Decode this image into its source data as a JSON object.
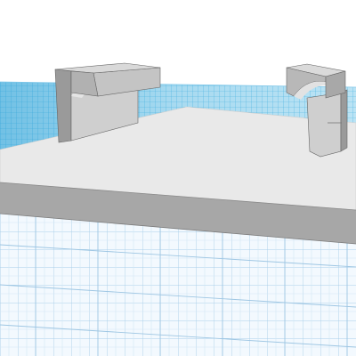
{
  "app": {
    "view": "3d-viewport",
    "theme_colors": {
      "sky": "#ffffff",
      "grid_back_light": "#bfe6f4",
      "grid_back_dark": "#2aa3d6",
      "grid_front": "#b9d8ef",
      "grid_front_bg": "#f6fbff",
      "plate_top": "#e8e8e8",
      "plate_side": "#a8a8a8",
      "part_light": "#d0d0d0",
      "part_mid": "#b5b5b5",
      "part_dark": "#8e8e8e",
      "edge": "#555555"
    }
  },
  "scene": {
    "objects": [
      {
        "name": "base-plate",
        "shape": "box"
      },
      {
        "name": "left-clip-bracket",
        "shape": "arched-bracket"
      },
      {
        "name": "right-clip-bracket",
        "shape": "arched-bracket"
      }
    ]
  }
}
